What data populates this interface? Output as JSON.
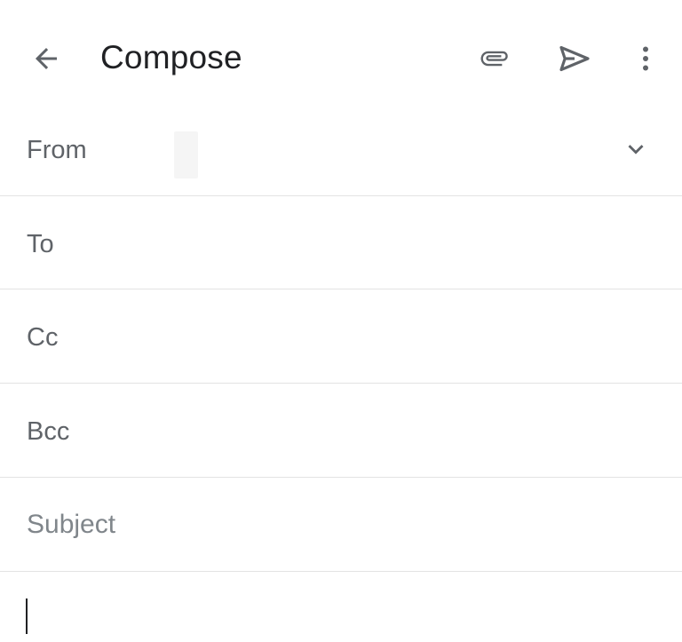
{
  "appbar": {
    "title": "Compose",
    "icons": {
      "back": "arrow-back-icon",
      "attach": "paperclip-icon",
      "send": "send-icon",
      "more": "more-vert-icon"
    }
  },
  "fields": {
    "from_label": "From",
    "from_value": "",
    "to_label": "To",
    "cc_label": "Cc",
    "bcc_label": "Bcc",
    "subject_placeholder": "Subject",
    "body_value": ""
  },
  "colors": {
    "text_primary": "#202124",
    "text_secondary": "#5f6368",
    "placeholder": "#80868b",
    "divider": "#e3e3e3",
    "icon": "#5f6368"
  }
}
